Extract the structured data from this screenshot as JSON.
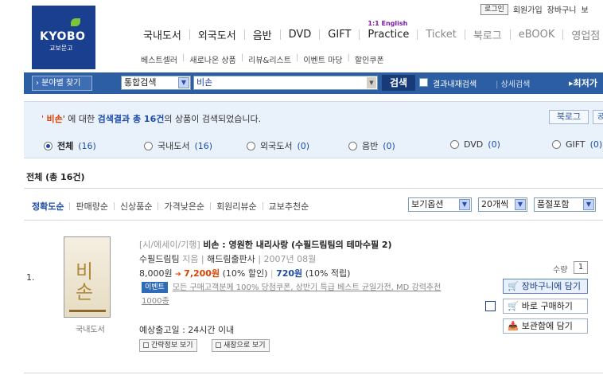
{
  "header": {
    "logo_text": "KYOBO",
    "logo_sub": "교보문고",
    "util_links": [
      "로그인",
      "회원가입",
      "장바구니",
      "보"
    ],
    "gnb": [
      {
        "label": "국내도서",
        "style": "dark"
      },
      {
        "label": "외국도서",
        "style": "dark"
      },
      {
        "label": "음반",
        "style": "dark"
      },
      {
        "label": "DVD",
        "style": "dark"
      },
      {
        "label": "GIFT",
        "style": "dark"
      },
      {
        "label": "Practice",
        "style": "dark",
        "sup": "1:1 English"
      },
      {
        "label": "Ticket",
        "style": "light"
      },
      {
        "label": "북로그",
        "style": "light"
      },
      {
        "label": "eBOOK",
        "style": "light"
      },
      {
        "label": "영업점",
        "style": "light"
      }
    ],
    "subnav": [
      "베스트셀러",
      "새로나온 상품",
      "리뷰&리스트",
      "이벤트 마당",
      "할인쿠폰"
    ]
  },
  "search": {
    "category_button": "› 분야별 찾기",
    "scope_select": "통합검색",
    "query": "비손",
    "submit": "검색",
    "within_results_label": "결과내재검색",
    "advanced_label": "상세검색",
    "bestseller_label": "▸최저가"
  },
  "results": {
    "keyword": "비손",
    "summary_mid": "' 에 대한 ",
    "summary_hl": "검색결과 총 16건",
    "summary_tail": "의 상품이 검색되었습니다.",
    "blog_btn": "북로그",
    "more_btn": "공",
    "tabs": [
      {
        "label": "전체",
        "count": "(16)",
        "selected": true
      },
      {
        "label": "국내도서",
        "count": "(16)",
        "selected": false
      },
      {
        "label": "외국도서",
        "count": "(0)",
        "selected": false
      },
      {
        "label": "음반",
        "count": "(0)",
        "selected": false
      },
      {
        "label": "DVD",
        "count": "(0)",
        "selected": false
      },
      {
        "label": "GIFT",
        "count": "(0)",
        "selected": false
      }
    ],
    "total_label": "전체 (총 16건)"
  },
  "sort": {
    "options": [
      "정확도순",
      "판매량순",
      "신상품순",
      "가격낮은순",
      "회원리뷰순",
      "교보추천순"
    ],
    "view_option": "보기옵션",
    "per_page": "20개씩",
    "stock": "품절포함"
  },
  "product": {
    "index": "1.",
    "cover_text": "비손",
    "category": "국내도서",
    "genre": "[시/에세이/기행]",
    "title": "비손 : 영원한 내리사랑 (수필드림팀의 테마수필 2)",
    "author": "수필드림팀",
    "author_role": "지음",
    "publisher": "해드림출판사",
    "date": "2007년 08월",
    "list_price": "8,000원",
    "arrow": "➔",
    "sale_price": "7,200원",
    "discount": "(10% 할인)",
    "points": "720원",
    "points_rate": "(10% 적립)",
    "event_tag": "이벤트",
    "event_text": "모든 구매고객분께 100% 당첨쿠폰, 상반기 특급 베스트 균일가전, MD 강력추천 1000종",
    "ship_label": "예상출고일 : 24시간 이내",
    "btn_quick": "간략정보 보기",
    "btn_new_window": "새창으로 보기",
    "qty_label": "수량",
    "qty_value": "1",
    "btn_cart": "장바구니에 담기",
    "btn_buy": "바로 구매하기",
    "btn_wish": "보관함에 담기"
  }
}
